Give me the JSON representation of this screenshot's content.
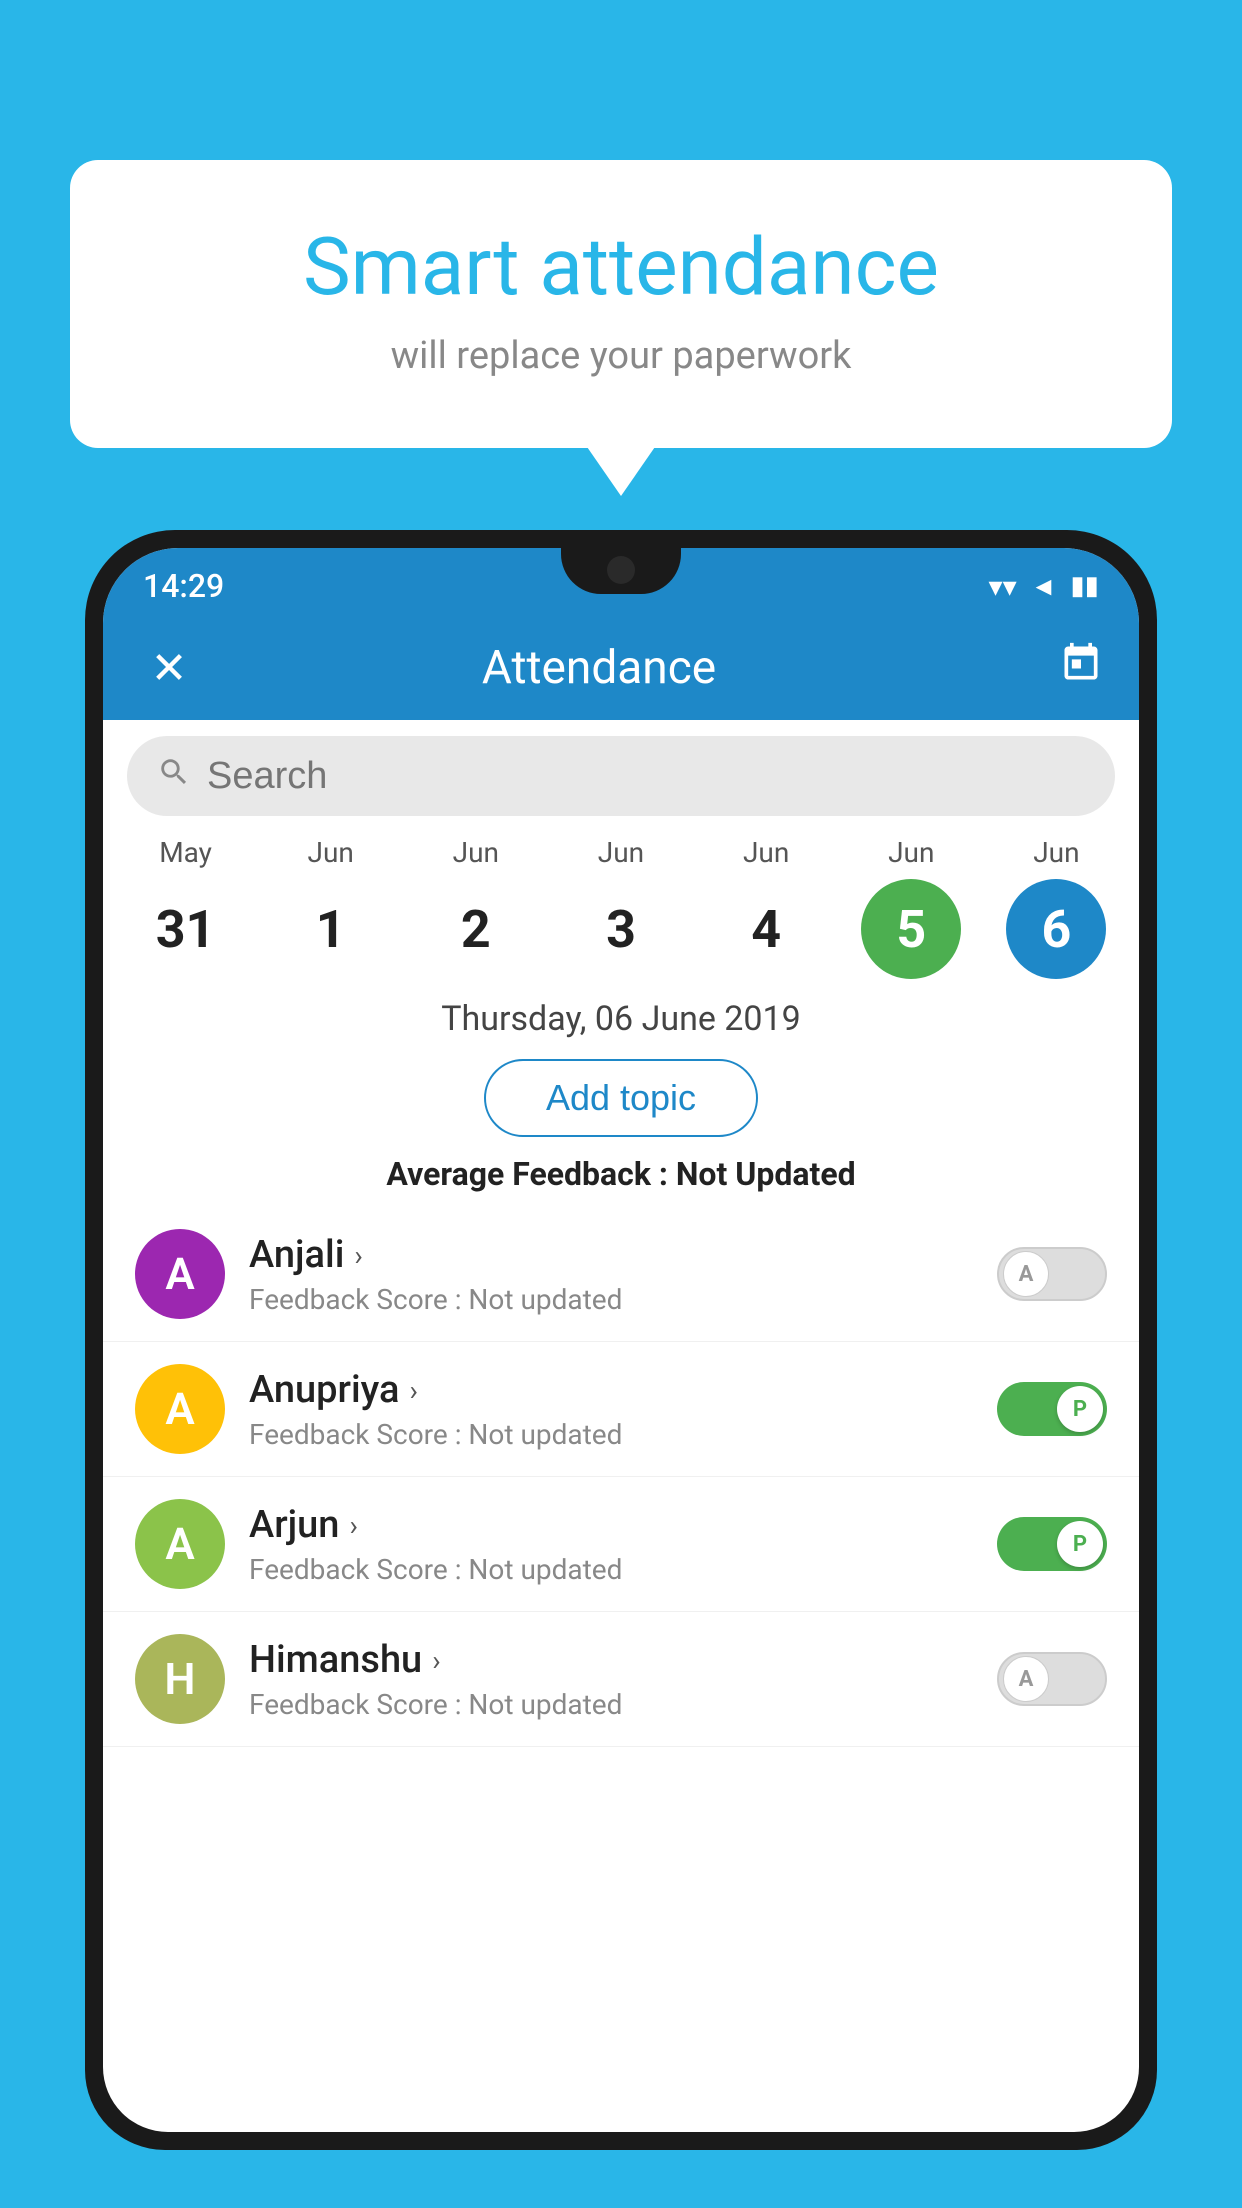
{
  "background_color": "#29b6e8",
  "bubble": {
    "title": "Smart attendance",
    "subtitle": "will replace your paperwork"
  },
  "status_bar": {
    "time": "14:29",
    "wifi": "▼",
    "signal": "▲",
    "battery": "▮"
  },
  "top_bar": {
    "close_label": "✕",
    "title": "Attendance",
    "calendar_label": "📅"
  },
  "search": {
    "placeholder": "Search"
  },
  "calendar": {
    "days": [
      {
        "month": "May",
        "date": "31",
        "style": "normal"
      },
      {
        "month": "Jun",
        "date": "1",
        "style": "normal"
      },
      {
        "month": "Jun",
        "date": "2",
        "style": "normal"
      },
      {
        "month": "Jun",
        "date": "3",
        "style": "normal"
      },
      {
        "month": "Jun",
        "date": "4",
        "style": "normal"
      },
      {
        "month": "Jun",
        "date": "5",
        "style": "today"
      },
      {
        "month": "Jun",
        "date": "6",
        "style": "selected"
      }
    ]
  },
  "selected_date": "Thursday, 06 June 2019",
  "add_topic_label": "Add topic",
  "avg_feedback_label": "Average Feedback :",
  "avg_feedback_value": "Not Updated",
  "students": [
    {
      "name": "Anjali",
      "initial": "A",
      "avatar_color": "#9c27b0",
      "feedback_label": "Feedback Score :",
      "feedback_value": "Not updated",
      "toggle_state": "off",
      "toggle_letter": "A"
    },
    {
      "name": "Anupriya",
      "initial": "A",
      "avatar_color": "#ffc107",
      "feedback_label": "Feedback Score :",
      "feedback_value": "Not updated",
      "toggle_state": "on",
      "toggle_letter": "P"
    },
    {
      "name": "Arjun",
      "initial": "A",
      "avatar_color": "#8bc34a",
      "feedback_label": "Feedback Score :",
      "feedback_value": "Not updated",
      "toggle_state": "on",
      "toggle_letter": "P"
    },
    {
      "name": "Himanshu",
      "initial": "H",
      "avatar_color": "#aab65a",
      "feedback_label": "Feedback Score :",
      "feedback_value": "Not updated",
      "toggle_state": "off",
      "toggle_letter": "A"
    }
  ]
}
